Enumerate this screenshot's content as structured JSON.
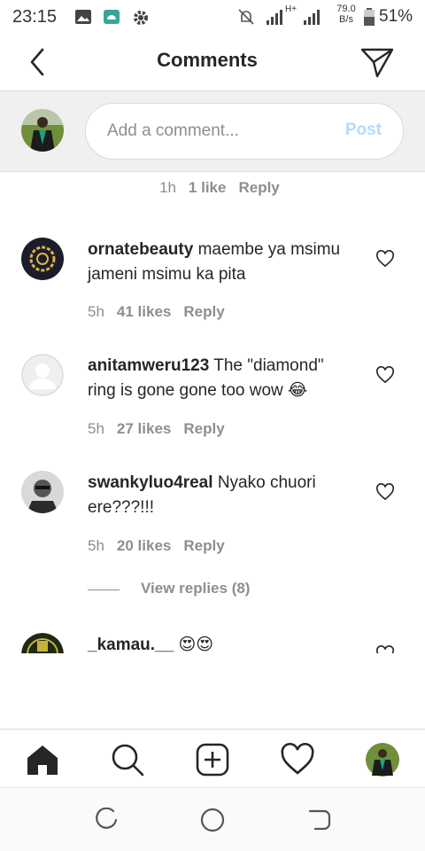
{
  "status_bar": {
    "time": "23:15",
    "network_type": "H+",
    "speed_value": "79.0",
    "speed_unit": "B/s",
    "battery": "51%",
    "icons": [
      "image-icon",
      "android-icon",
      "gear-icon",
      "muted-bell-icon",
      "signal-icon",
      "signal-icon",
      "battery-icon"
    ]
  },
  "header": {
    "title": "Comments",
    "back_icon": "chevron-left-icon",
    "send_icon": "paper-plane-icon"
  },
  "compose": {
    "placeholder": "Add a comment...",
    "value": "",
    "post_label": "Post",
    "post_color": "#b3dbff"
  },
  "previous_comment_meta": {
    "time": "1h",
    "likes": "1 like",
    "reply": "Reply"
  },
  "comments": [
    {
      "username": "ornatebeauty",
      "text": "maembe ya msimu jameni msimu ka pita",
      "time": "5h",
      "likes": "41 likes",
      "reply": "Reply"
    },
    {
      "username": "anitamweru123",
      "text": "The \"diamond\" ring is gone gone too wow 😂",
      "time": "5h",
      "likes": "27 likes",
      "reply": "Reply"
    },
    {
      "username": "swankyluo4real",
      "text": "Nyako chuori ere???!!!",
      "time": "5h",
      "likes": "20 likes",
      "reply": "Reply",
      "view_replies": "View replies (8)"
    },
    {
      "username": "_kamau.__",
      "text": "😍😍"
    }
  ],
  "bottom_nav": [
    "home-icon",
    "search-icon",
    "add-post-icon",
    "heart-icon",
    "profile-avatar"
  ],
  "android_nav": [
    "recents-icon",
    "home-circle-icon",
    "back-icon"
  ],
  "colors": {
    "text": "#262626",
    "secondary": "#8e8e8e",
    "border": "#dbdbdb",
    "compose_bg": "#f0f0f0",
    "accent": "#3897f0"
  }
}
